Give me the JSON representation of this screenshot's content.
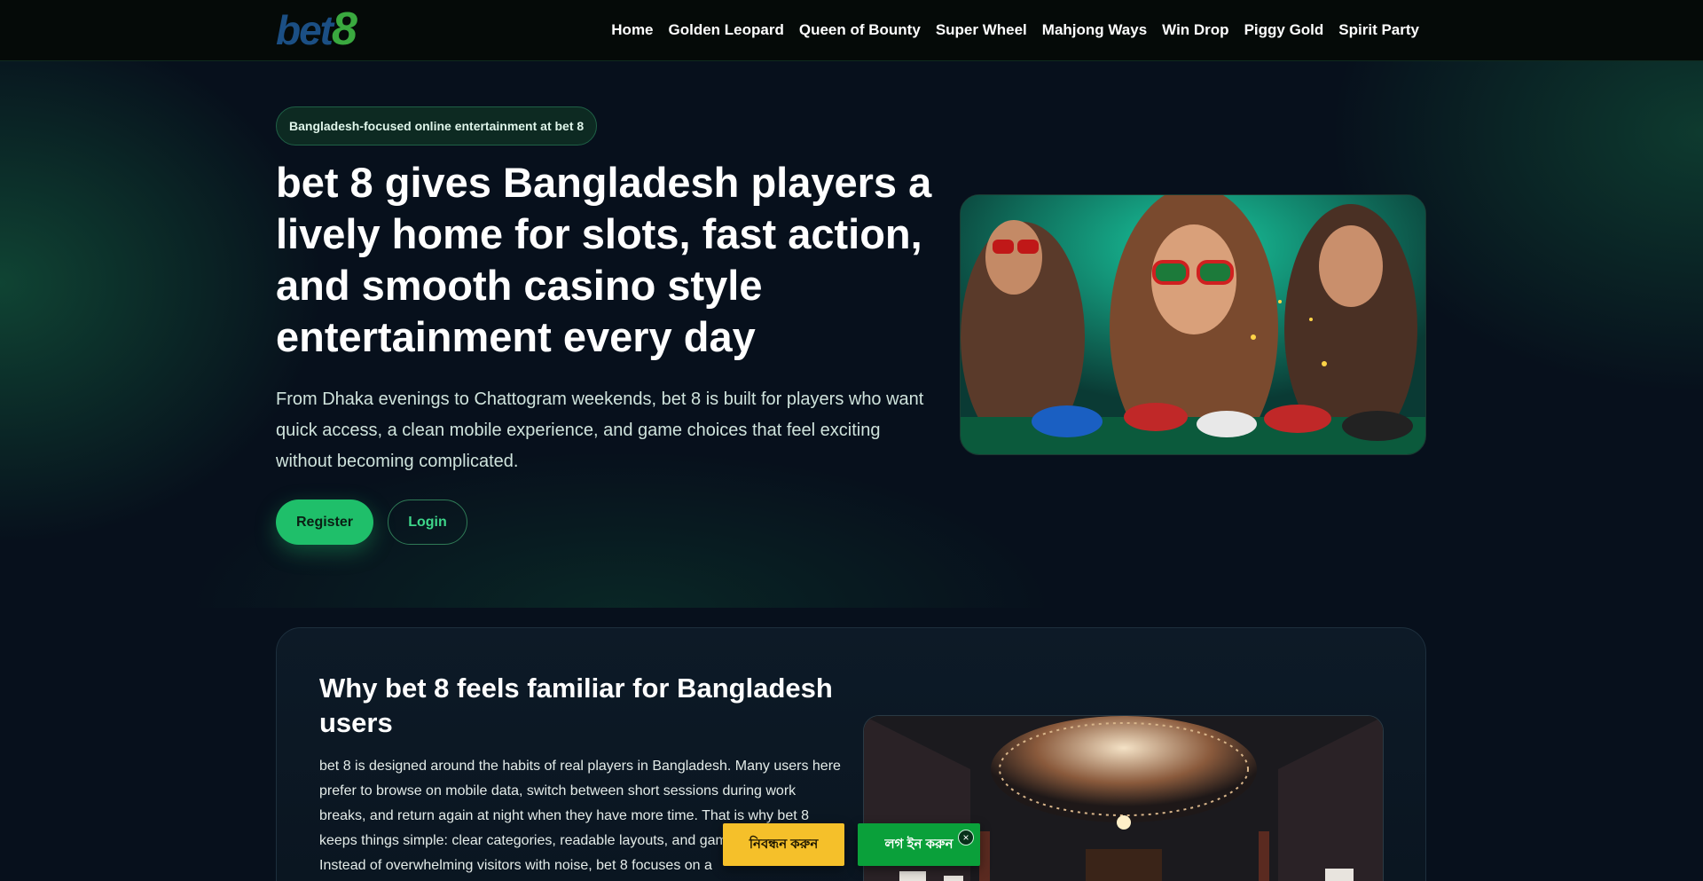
{
  "header": {
    "logo_part1": "bet",
    "logo_part2": "8",
    "nav": [
      {
        "label": "Home"
      },
      {
        "label": "Golden Leopard"
      },
      {
        "label": "Queen of Bounty"
      },
      {
        "label": "Super Wheel"
      },
      {
        "label": "Mahjong Ways"
      },
      {
        "label": "Win Drop"
      },
      {
        "label": "Piggy Gold"
      },
      {
        "label": "Spirit Party"
      }
    ]
  },
  "hero": {
    "badge": "Bangladesh-focused online entertainment at bet 8",
    "title": "bet 8 gives Bangladesh players a lively home for slots, fast action, and smooth casino style entertainment every day",
    "description": "From Dhaka evenings to Chattogram weekends, bet 8 is built for players who want quick access, a clean mobile experience, and game choices that feel exciting without becoming complicated.",
    "register_label": "Register",
    "login_label": "Login"
  },
  "section": {
    "title": "Why bet 8 feels familiar for Bangladesh users",
    "text": "bet 8 is designed around the habits of real players in Bangladesh. Many users here prefer to browse on mobile data, switch between short sessions during work breaks, and return again at night when they have more time. That is why bet 8 keeps things simple: clear categories, readable layouts, and game without clutter. Instead of overwhelming visitors with noise, bet 8 focuses on a"
  },
  "floating": {
    "register_label": "নিবন্ধন করুন",
    "login_label": "লগ ইন করুন",
    "close_symbol": "×"
  },
  "colors": {
    "accent_green": "#1fbf6a",
    "float_register_yellow": "#f5c02a",
    "float_login_green": "#0aa03a",
    "background": "#07101c"
  }
}
